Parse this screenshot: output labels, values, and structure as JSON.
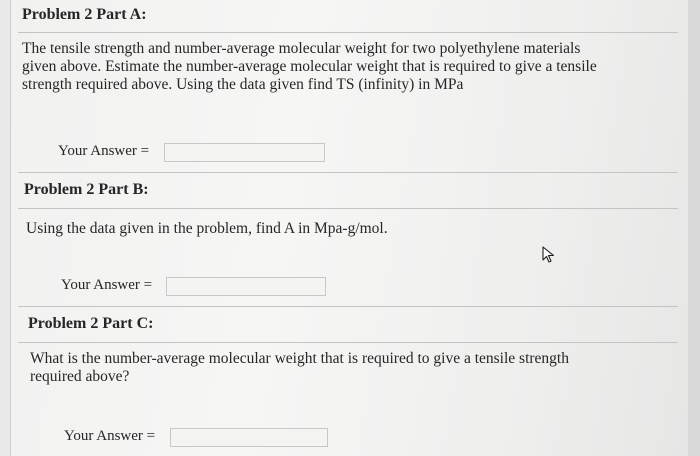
{
  "part_a": {
    "heading": "Problem 2 Part A:",
    "question_lines": [
      "The tensile strength and number-average molecular weight for two polyethylene materials",
      "given above. Estimate the number-average molecular weight that is required to give a tensile",
      "strength required above. Using the data given find TS (infinity) in MPa"
    ],
    "answer_label": "Your Answer =",
    "answer_value": ""
  },
  "part_b": {
    "heading": "Problem 2 Part B:",
    "question": "Using the data given in the problem, find A in Mpa-g/mol.",
    "answer_label": "Your Answer =",
    "answer_value": ""
  },
  "part_c": {
    "heading": "Problem 2 Part C:",
    "question_lines": [
      "What is the number-average molecular weight that is required to give a tensile strength",
      "required above?"
    ],
    "answer_label": "Your Answer =",
    "answer_value": ""
  },
  "icons": {
    "cursor": "mouse-pointer-icon"
  }
}
